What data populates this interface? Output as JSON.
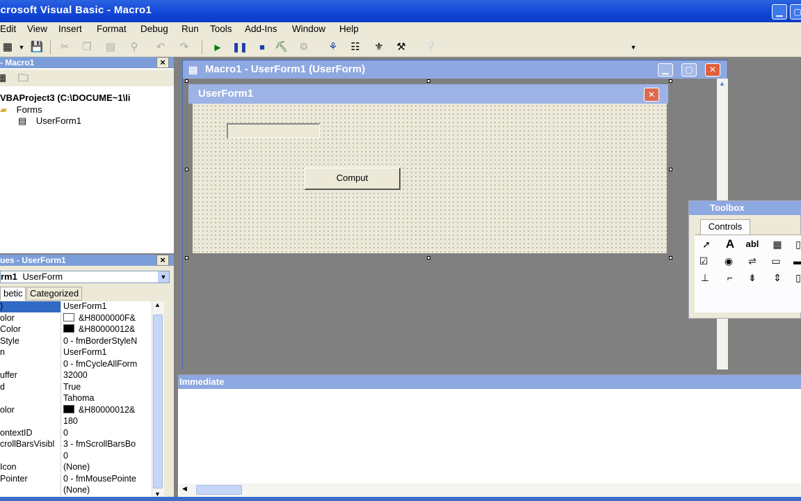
{
  "window": {
    "title": "icrosoft Visual Basic - Macro1"
  },
  "menu": [
    "Edit",
    "View",
    "Insert",
    "Format",
    "Debug",
    "Run",
    "Tools",
    "Add-Ins",
    "Window",
    "Help"
  ],
  "project": {
    "title": "- Macro1",
    "root": "VBAProject3 (C:\\DOCUME~1\\li",
    "folder": "Forms",
    "item": "UserForm1"
  },
  "properties": {
    "title": "ues - UserForm1",
    "object_name": "rm1",
    "object_type": "UserForm",
    "tabs": [
      "betic",
      "Categorized"
    ],
    "rows": [
      {
        "name": ")",
        "value": "UserForm1",
        "selected": true
      },
      {
        "name": "olor",
        "value": "&H8000000F&",
        "swatch": "#ffffff"
      },
      {
        "name": "Color",
        "value": "&H80000012&",
        "swatch": "#000000"
      },
      {
        "name": "Style",
        "value": "0 - fmBorderStyleN"
      },
      {
        "name": "n",
        "value": "UserForm1"
      },
      {
        "name": "",
        "value": "0 - fmCycleAllForm"
      },
      {
        "name": "uffer",
        "value": "32000"
      },
      {
        "name": "d",
        "value": "True"
      },
      {
        "name": "",
        "value": "Tahoma"
      },
      {
        "name": "olor",
        "value": "&H80000012&",
        "swatch": "#000000"
      },
      {
        "name": "",
        "value": "180"
      },
      {
        "name": "ontextID",
        "value": "0"
      },
      {
        "name": "crollBarsVisibl",
        "value": "3 - fmScrollBarsBo"
      },
      {
        "name": "",
        "value": "0"
      },
      {
        "name": "Icon",
        "value": "(None)"
      },
      {
        "name": "Pointer",
        "value": "0 - fmMousePointe"
      },
      {
        "name": "",
        "value": "(None)"
      }
    ]
  },
  "code_window": {
    "title": "Macro1 - UserForm1 (UserForm)"
  },
  "userform": {
    "title": "UserForm1",
    "button_label": "Comput"
  },
  "toolbox": {
    "title": "Toolbox",
    "tab": "Controls"
  },
  "immediate": {
    "title": "Immediate"
  }
}
